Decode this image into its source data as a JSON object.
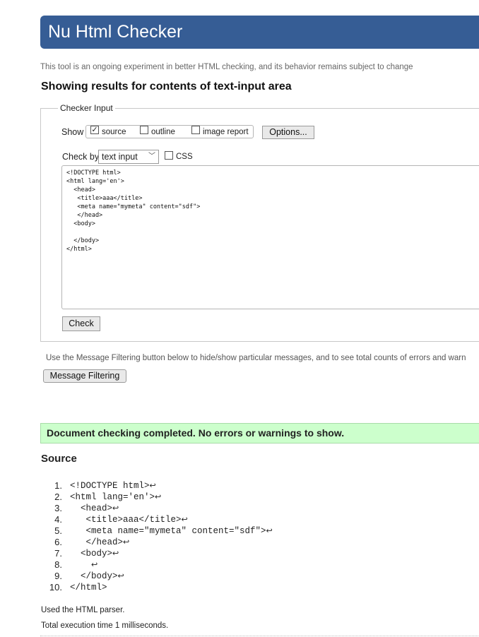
{
  "header": {
    "title": "Nu Html Checker"
  },
  "intro_text": "This tool is an ongoing experiment in better HTML checking, and its behavior remains subject to change",
  "results_heading": "Showing results for contents of text-input area",
  "checker_input": {
    "legend": "Checker Input",
    "show_label": "Show",
    "show_options": [
      {
        "label": "source",
        "checked": true
      },
      {
        "label": "outline",
        "checked": false
      },
      {
        "label": "image report",
        "checked": false
      }
    ],
    "options_button": "Options...",
    "check_by_label": "Check by",
    "check_by_value": "text input",
    "css_label": "CSS",
    "css_checked": false,
    "textarea_value": "<!DOCTYPE html>\n<html lang='en'>\n  <head>\n   <title>aaa</title>\n   <meta name=\"mymeta\" content=\"sdf\">\n   </head>\n  <body>\n\n  </body>\n</html>",
    "check_button": "Check"
  },
  "filter_note": "Use the Message Filtering button below to hide/show particular messages, and to see total counts of errors and warn",
  "message_filtering_button": "Message Filtering",
  "status_message": "Document checking completed. No errors or warnings to show.",
  "source": {
    "heading": "Source",
    "lines": [
      {
        "num": "1.",
        "code": "<!DOCTYPE html>"
      },
      {
        "num": "2.",
        "code": "<html lang='en'>"
      },
      {
        "num": "3.",
        "code": "  <head>"
      },
      {
        "num": "4.",
        "code": "   <title>aaa</title>"
      },
      {
        "num": "5.",
        "code": "   <meta name=\"mymeta\" content=\"sdf\">"
      },
      {
        "num": "6.",
        "code": "   </head>"
      },
      {
        "num": "7.",
        "code": "  <body>"
      },
      {
        "num": "8.",
        "code": "    "
      },
      {
        "num": "9.",
        "code": "  </body>"
      },
      {
        "num": "10.",
        "code": "</html>"
      }
    ],
    "return_symbol": "↩"
  },
  "footer": {
    "parser_text": "Used the HTML parser.",
    "execution_text": "Total execution time 1 milliseconds."
  },
  "colors": {
    "banner": "#365d95",
    "success_bg": "#ccffcc"
  }
}
